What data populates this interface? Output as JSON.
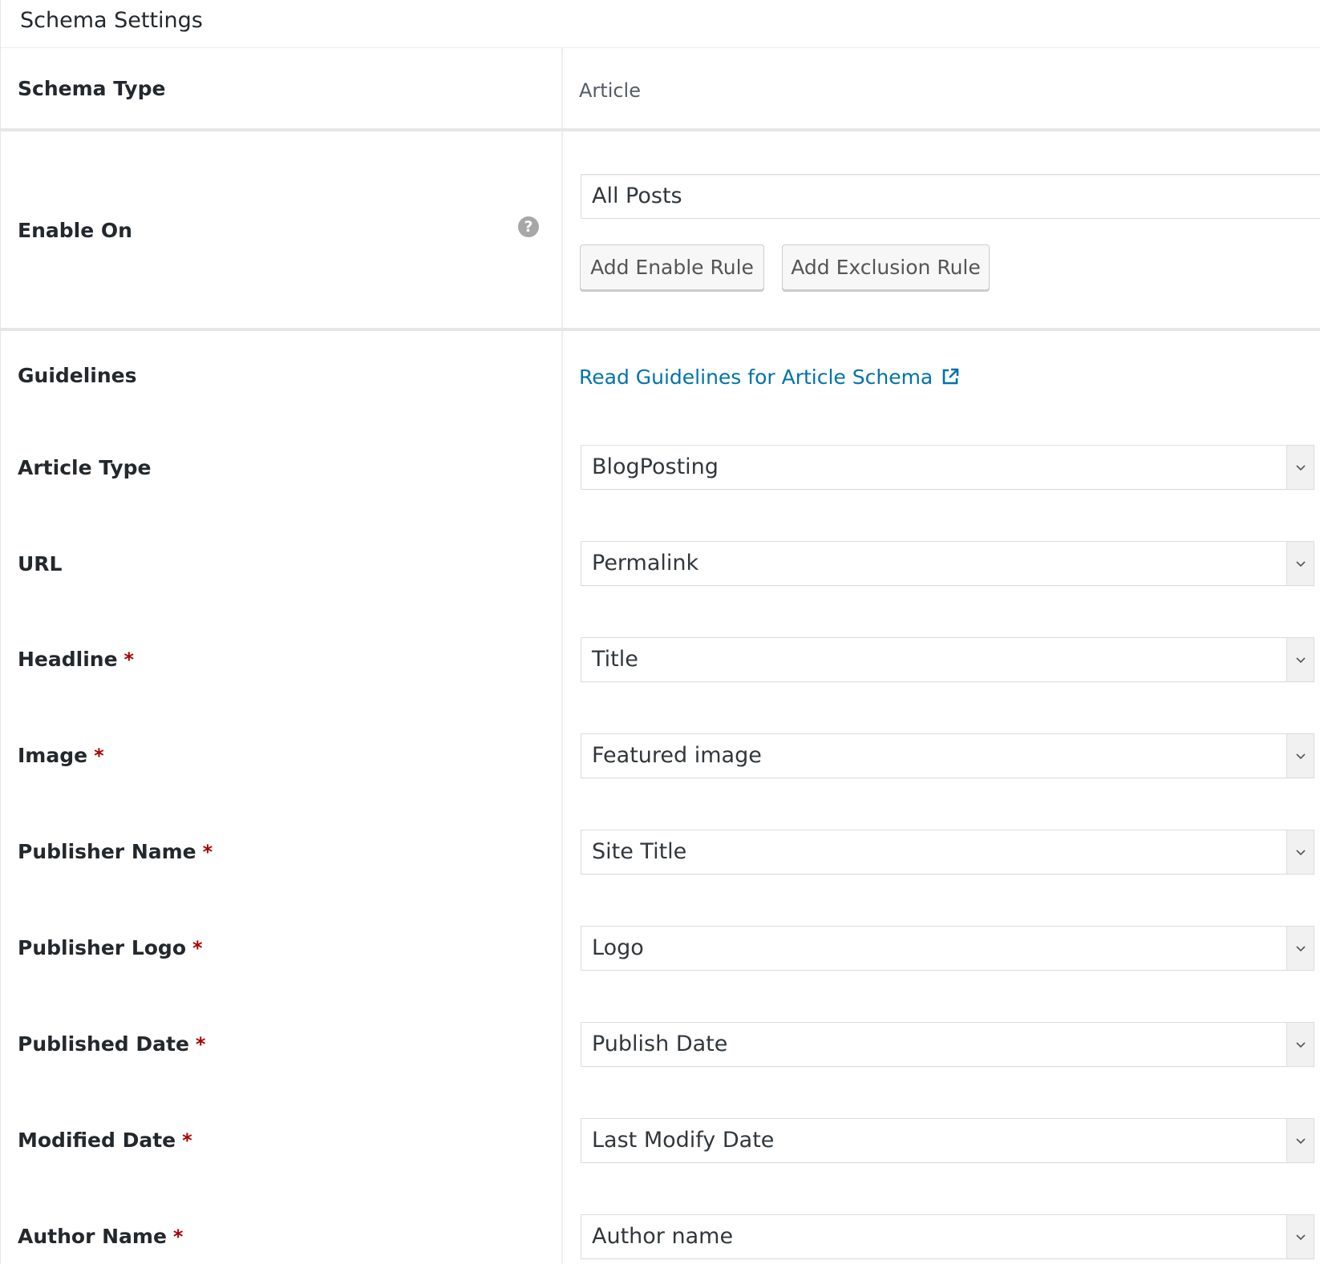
{
  "panel": {
    "title": "Schema Settings"
  },
  "schema_type": {
    "label": "Schema Type",
    "value": "Article"
  },
  "enable_on": {
    "label": "Enable On",
    "help_icon": "question-circle-icon",
    "value": "All Posts",
    "add_enable_rule": "Add Enable Rule",
    "add_exclusion_rule": "Add Exclusion Rule"
  },
  "guidelines": {
    "label": "Guidelines",
    "link_text": "Read Guidelines for Article Schema",
    "link_icon": "external-link-icon"
  },
  "fields": [
    {
      "label": "Article Type",
      "required": false,
      "value": "BlogPosting"
    },
    {
      "label": "URL",
      "required": false,
      "value": "Permalink"
    },
    {
      "label": "Headline",
      "required": true,
      "value": "Title"
    },
    {
      "label": "Image",
      "required": true,
      "value": "Featured image"
    },
    {
      "label": "Publisher Name",
      "required": true,
      "value": "Site Title"
    },
    {
      "label": "Publisher Logo",
      "required": true,
      "value": "Logo"
    },
    {
      "label": "Published Date",
      "required": true,
      "value": "Publish Date"
    },
    {
      "label": "Modified Date",
      "required": true,
      "value": "Last Modify Date"
    },
    {
      "label": "Author Name",
      "required": true,
      "value": "Author name"
    }
  ],
  "required_marker": "*",
  "colors": {
    "link": "#0073aa",
    "required": "#aa0000",
    "text": "#23282d"
  }
}
